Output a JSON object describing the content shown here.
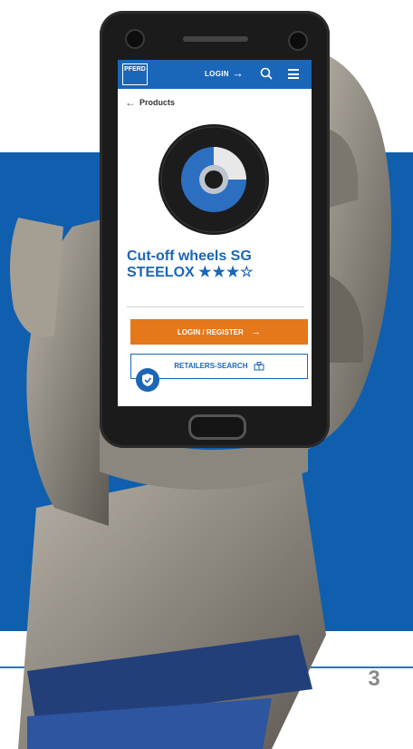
{
  "app": {
    "logo_text": "PFERD",
    "login_label": "LOGIN",
    "icons": [
      "arrow-right-icon",
      "search-icon",
      "menu-icon",
      "back-arrow-icon",
      "shield-icon",
      "store-icon"
    ]
  },
  "breadcrumb": {
    "label": "Products"
  },
  "product": {
    "title_line1": "Cut-off wheels SG",
    "title_line2": "STEELOX",
    "stars": "★★★☆",
    "rating": 3,
    "rating_max": 4
  },
  "buttons": {
    "login_register": "LOGIN / REGISTER",
    "retailers_search": "RETAILERS-SEARCH"
  },
  "page": {
    "number": "3"
  },
  "colors": {
    "brand_blue": "#1a66b8",
    "accent_orange": "#e5781a",
    "panel_blue": "#0f5fae"
  }
}
